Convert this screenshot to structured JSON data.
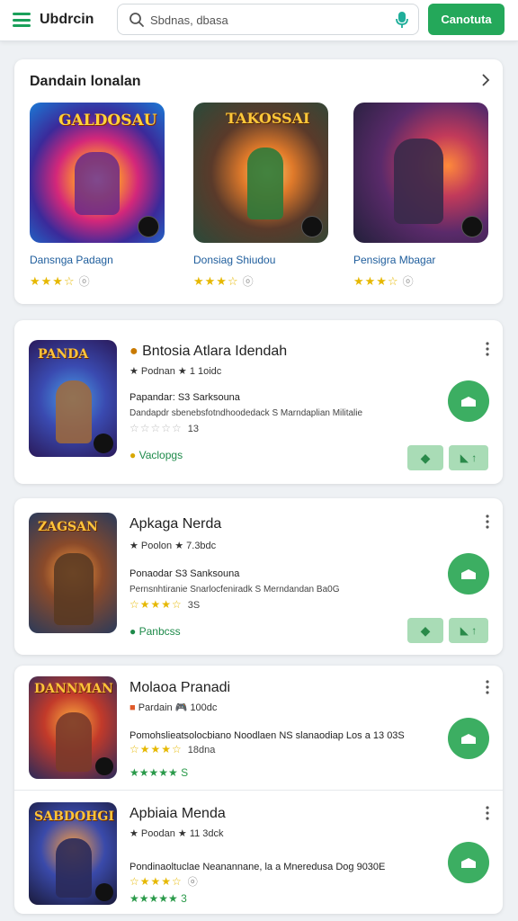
{
  "header": {
    "brand": "Ubdrcin",
    "search_placeholder": "Sbdnas, dbasa",
    "cta_label": "Canotuta"
  },
  "featured": {
    "title": "Dandain lonalan",
    "items": [
      {
        "name": "Dansnga Padagn",
        "rating_stars": "★★★☆",
        "art_text": "GALDOSAU"
      },
      {
        "name": "Donsiag Shiudou",
        "rating_stars": "★★★☆",
        "art_text": "TAKOSSAI"
      },
      {
        "name": "Pensigra Mbagar",
        "rating_stars": "★★★☆",
        "art_text": ""
      }
    ]
  },
  "apps": [
    {
      "title": "Bntosia Atlara Idendah",
      "sub": "★ Podnan ★ 1 1oidc",
      "desc1": "Papandar: S3 Sarksouna",
      "desc2": "Dandapdr sbenebsfotndhoodedack S Marndaplian Militalie",
      "stars": "☆☆☆☆☆",
      "stars_value": "13",
      "tag": "Vaclopgs",
      "art_text": "PANDA"
    },
    {
      "title": "Apkaga Nerda",
      "sub": "★ Poolon ★ 7.3bdc",
      "desc1": "Ponaodar S3 Sanksouna",
      "desc2": "Pernsnhtiranie Snarlocfeniradk S Merndandan Ba0G",
      "stars": "☆★★★☆",
      "stars_value": "3S",
      "tag": "Panbcss",
      "art_text": "ZAGSAN"
    },
    {
      "title": "Molaoa Pranadi",
      "sub": "Pardain 🎮 100dc",
      "desc1": "Pomohslieatsolocbiano Noodlaen NS slanaodiap Los a 13 03S",
      "desc2": "",
      "stars": "☆★★★☆",
      "stars_value": "18dna",
      "tag": "★★★★★ S",
      "art_text": "DANNMAN"
    },
    {
      "title": "Apbiaia Menda",
      "sub": "★ Poodan ★ 11 3dck",
      "desc1": "Pondinaoltuclae Neanannane, la a Mneredusa Dog 9030E",
      "desc2": "",
      "stars": "☆★★★☆",
      "stars_value": "",
      "tag": "★★★★★ 3",
      "art_text": "SABDOHGI"
    }
  ],
  "colors": {
    "accent": "#24a85a",
    "link": "#1e5d9c",
    "star": "#e6b800"
  }
}
